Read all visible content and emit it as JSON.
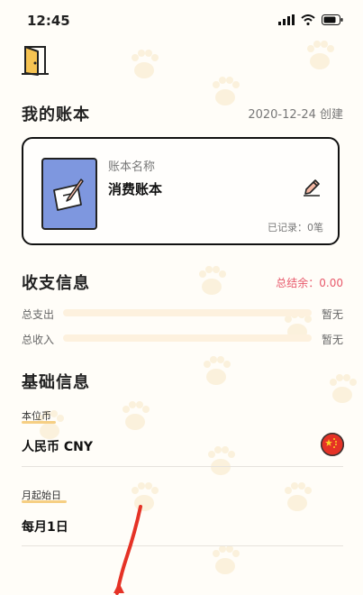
{
  "status_bar": {
    "time": "12:45"
  },
  "ledger": {
    "title": "我的账本",
    "created": "2020-12-24 创建",
    "card": {
      "name_label": "账本名称",
      "name": "消费账本",
      "record_count": "已记录：0笔"
    }
  },
  "income_expense": {
    "title": "收支信息",
    "balance": "总结余：0.00",
    "rows": [
      {
        "label": "总支出",
        "value": "暂无"
      },
      {
        "label": "总收入",
        "value": "暂无"
      }
    ]
  },
  "basic_info": {
    "title": "基础信息",
    "currency_label": "本位币",
    "currency_value": "人民币 CNY",
    "start_day_label": "月起始日",
    "start_day_value": "每月1日"
  },
  "colors": {
    "accent": "#f6cf83",
    "balance": "#e8596b",
    "book": "#7e97df",
    "flag": "#e53226"
  },
  "icons": [
    "door-icon",
    "book-icon",
    "pencil-icon",
    "china-flag-icon",
    "signal-icon",
    "wifi-icon",
    "battery-icon"
  ]
}
